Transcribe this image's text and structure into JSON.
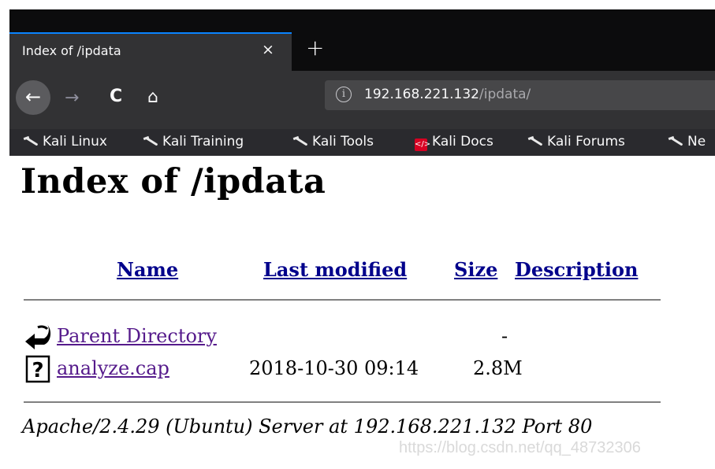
{
  "browser": {
    "tab": {
      "title": "Index of /ipdata",
      "close": "×"
    },
    "new_tab": "+",
    "nav": {
      "back": "←",
      "forward": "→",
      "reload": "C",
      "home": "⌂"
    },
    "url": {
      "info": "i",
      "host": "192.168.221.132",
      "path": "/ipdata/"
    },
    "bookmarks": [
      {
        "label": "Kali Linux",
        "icon": "kali-dragon-icon"
      },
      {
        "label": "Kali Training",
        "icon": "kali-dragon-icon"
      },
      {
        "label": "Kali Tools",
        "icon": "kali-dragon-icon"
      },
      {
        "label": "Kali Docs",
        "icon": "kali-docs-icon"
      },
      {
        "label": "Kali Forums",
        "icon": "kali-dragon-icon"
      },
      {
        "label": "Ne",
        "icon": "kali-dragon-icon"
      }
    ]
  },
  "page": {
    "title": "Index of /ipdata",
    "columns": {
      "name": "Name",
      "last_modified": "Last modified",
      "size": "Size",
      "description": "Description"
    },
    "rows": [
      {
        "name": "Parent Directory",
        "date": "",
        "size": "-",
        "icon": "back-arrow-icon"
      },
      {
        "name": "analyze.cap",
        "date": "2018-10-30 09:14",
        "size": "2.8M",
        "icon": "unknown-file-icon"
      }
    ],
    "address": "Apache/2.4.29 (Ubuntu) Server at 192.168.221.132 Port 80"
  },
  "watermark": "https://blog.csdn.net/qq_48732306",
  "colors": {
    "tab_accent": "#0a84ff",
    "link": "#00008b",
    "visited_link": "#551a8b"
  }
}
